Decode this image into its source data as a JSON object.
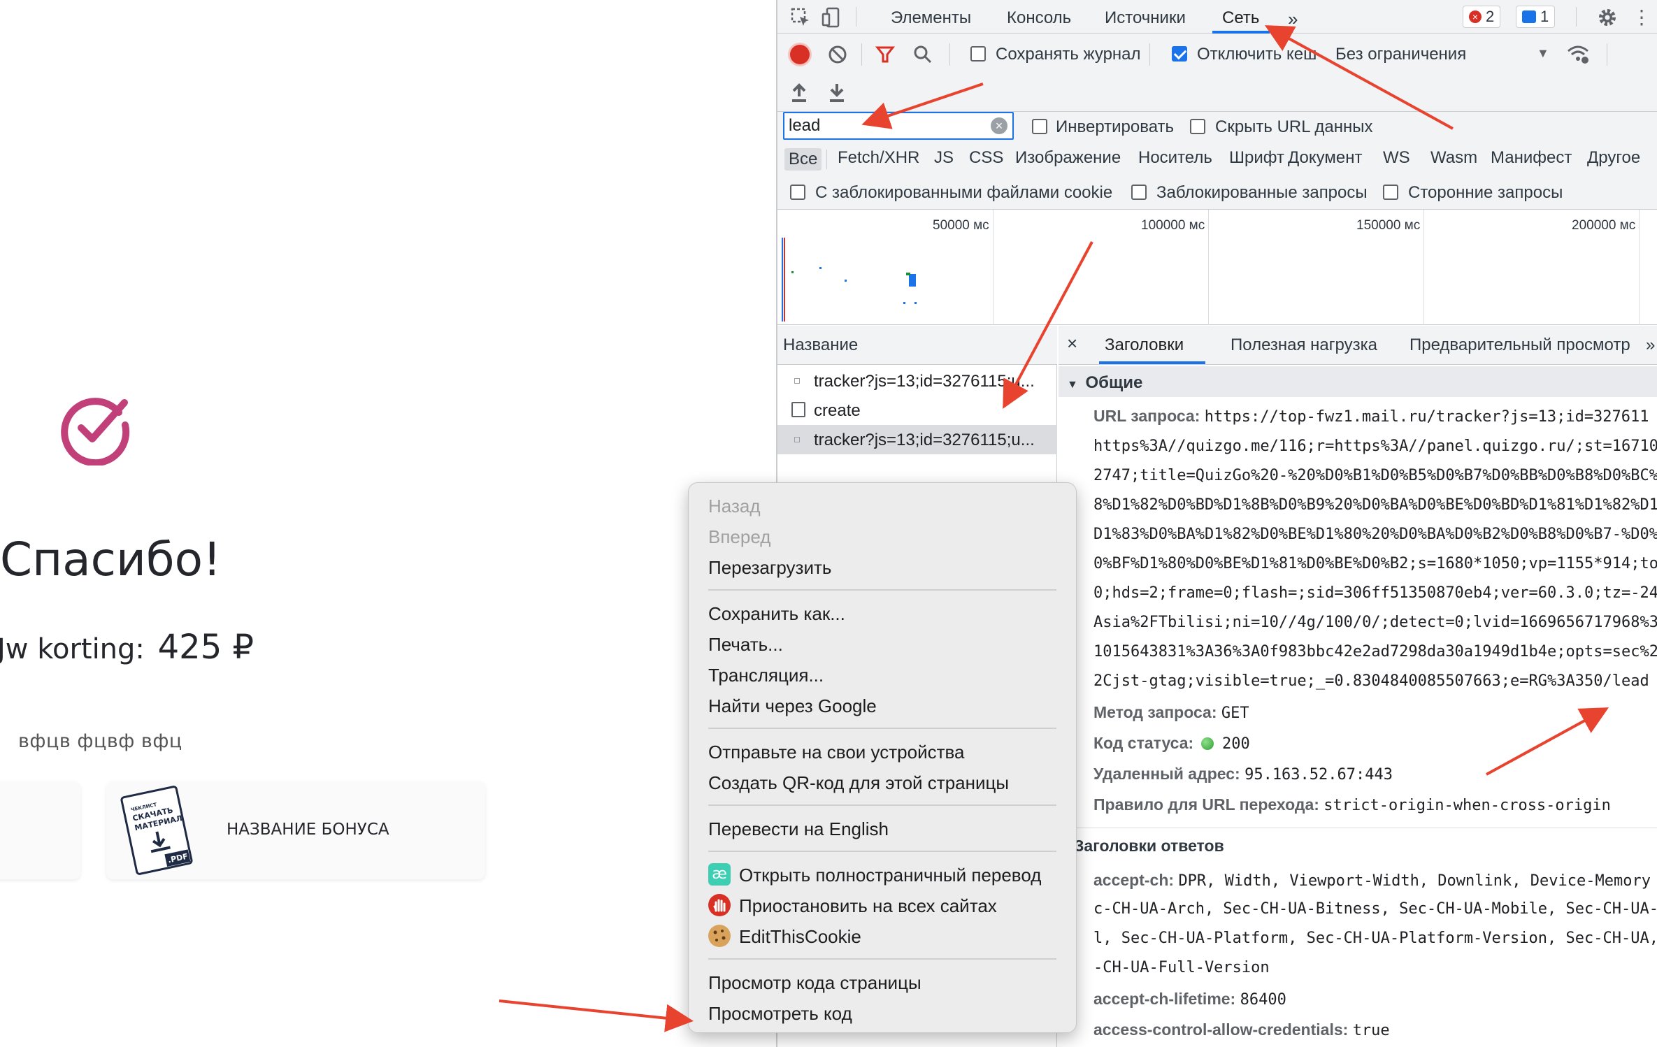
{
  "page": {
    "thanks": "Спасибо!",
    "discount_label": "Jw korting:",
    "discount_amount": "425 ₽",
    "sub_text": "вфцв фцвф вфц",
    "bonus_title": "НАЗВАНИЕ БОНУСА",
    "pdf_thumb": {
      "line1": "ЧЕКЛИСТ",
      "line2": "СКАЧАТЬ",
      "line3": "МАТЕРИАЛ",
      "badge": ".PDF"
    },
    "accent_color": "#c2407a"
  },
  "devtools": {
    "tabs": [
      "Элементы",
      "Консоль",
      "Источники",
      "Сеть"
    ],
    "more_tabs": "»",
    "errors_count": "2",
    "messages_count": "1",
    "toolbar": {
      "preserve_log": "Сохранять журнал",
      "disable_cache": "Отключить кеш",
      "throttling": "Без ограничения",
      "preserve_log_checked": false,
      "disable_cache_checked": true
    },
    "filter": {
      "value": "lead",
      "invert": "Инвертировать",
      "hide_data_urls": "Скрыть URL данных",
      "types": [
        "Все",
        "Fetch/XHR",
        "JS",
        "CSS",
        "Изображение",
        "Носитель",
        "Шрифт",
        "Документ",
        "WS",
        "Wasm",
        "Манифест",
        "Другое"
      ],
      "blocked_cookies": "С заблокированными файлами cookie",
      "blocked_requests": "Заблокированные запросы",
      "third_party": "Сторонние запросы"
    },
    "timeline_ticks": [
      "50000 мс",
      "100000 мс",
      "150000 мс",
      "200000 мс"
    ],
    "request_list": {
      "header": "Название",
      "rows": [
        "tracker?js=13;id=3276115;u...",
        "create",
        "tracker?js=13;id=3276115;u..."
      ]
    },
    "details": {
      "close": "×",
      "tabs": [
        "Заголовки",
        "Полезная нагрузка",
        "Предварительный просмотр"
      ],
      "more": "»",
      "general_title": "Общие",
      "request_url_label": "URL запроса:",
      "request_url_lines": [
        "https://top-fwz1.mail.ru/tracker?js=13;id=327611",
        "https%3A//quizgo.me/116;r=https%3A//panel.quizgo.ru/;st=16710",
        "2747;title=QuizGo%20-%20%D0%B1%D0%B5%D0%B7%D0%BB%D0%B8%D0%BC%",
        "8%D1%82%D0%BD%D1%8B%D0%B9%20%D0%BA%D0%BE%D0%BD%D1%81%D1%82%D1",
        "D1%83%D0%BA%D1%82%D0%BE%D1%80%20%D0%BA%D0%B2%D0%B8%D0%B7-%D0%",
        "0%BF%D1%80%D0%BE%D1%81%D0%BE%D0%B2;s=1680*1050;vp=1155*914;to",
        "0;hds=2;frame=0;flash=;sid=306ff51350870eb4;ver=60.3.0;tz=-24",
        "Asia%2FTbilisi;ni=10//4g/100/0/;detect=0;lvid=1669656717968%3",
        "1015643831%3A36%3A0f983bbc42e2ad7298da30a1949d1b4e;opts=sec%2",
        "2Cjst-gtag;visible=true;_=0.8304840085507663;e=RG%3A350/lead"
      ],
      "method_label": "Метод запроса:",
      "method": "GET",
      "status_label": "Код статуса:",
      "status": "200",
      "remote_label": "Удаленный адрес:",
      "remote": "95.163.52.67:443",
      "referrer_label": "Правило для URL перехода:",
      "referrer": "strict-origin-when-cross-origin",
      "response_title": "Заголовки ответов",
      "accept_ch_label": "accept-ch:",
      "accept_ch_lines": [
        "DPR, Width, Viewport-Width, Downlink, Device-Memory",
        "c-CH-UA-Arch, Sec-CH-UA-Bitness, Sec-CH-UA-Mobile, Sec-CH-UA-",
        "l, Sec-CH-UA-Platform, Sec-CH-UA-Platform-Version, Sec-CH-UA,",
        "-CH-UA-Full-Version"
      ],
      "accept_ch_lifetime_label": "accept-ch-lifetime:",
      "accept_ch_lifetime": "86400",
      "acac_label": "access-control-allow-credentials:",
      "acac": "true"
    }
  },
  "context_menu": {
    "items": [
      {
        "label": "Назад",
        "disabled": true
      },
      {
        "label": "Вперед",
        "disabled": true
      },
      {
        "label": "Перезагрузить",
        "disabled": false
      },
      {
        "label": "Сохранить как...",
        "disabled": false
      },
      {
        "label": "Печать...",
        "disabled": false
      },
      {
        "label": "Трансляция...",
        "disabled": false
      },
      {
        "label": "Найти через Google",
        "disabled": false
      },
      {
        "label": "Отправьте на свои устройства",
        "disabled": false
      },
      {
        "label": "Создать QR-код для этой страницы",
        "disabled": false
      },
      {
        "label": "Перевести на English",
        "disabled": false
      },
      {
        "label": "Открыть полностраничный перевод",
        "disabled": false,
        "icon": "translate-extension-icon"
      },
      {
        "label": "Приостановить на всех сайтах",
        "disabled": false,
        "icon": "adblock-stop-icon"
      },
      {
        "label": "EditThisCookie",
        "disabled": false,
        "icon": "cookie-icon"
      },
      {
        "label": "Просмотр кода страницы",
        "disabled": false
      },
      {
        "label": "Просмотреть код",
        "disabled": false
      }
    ]
  },
  "colors": {
    "annotation_arrow": "#e8432e",
    "devtools_accent": "#1a73e8",
    "record_red": "#d93025"
  }
}
